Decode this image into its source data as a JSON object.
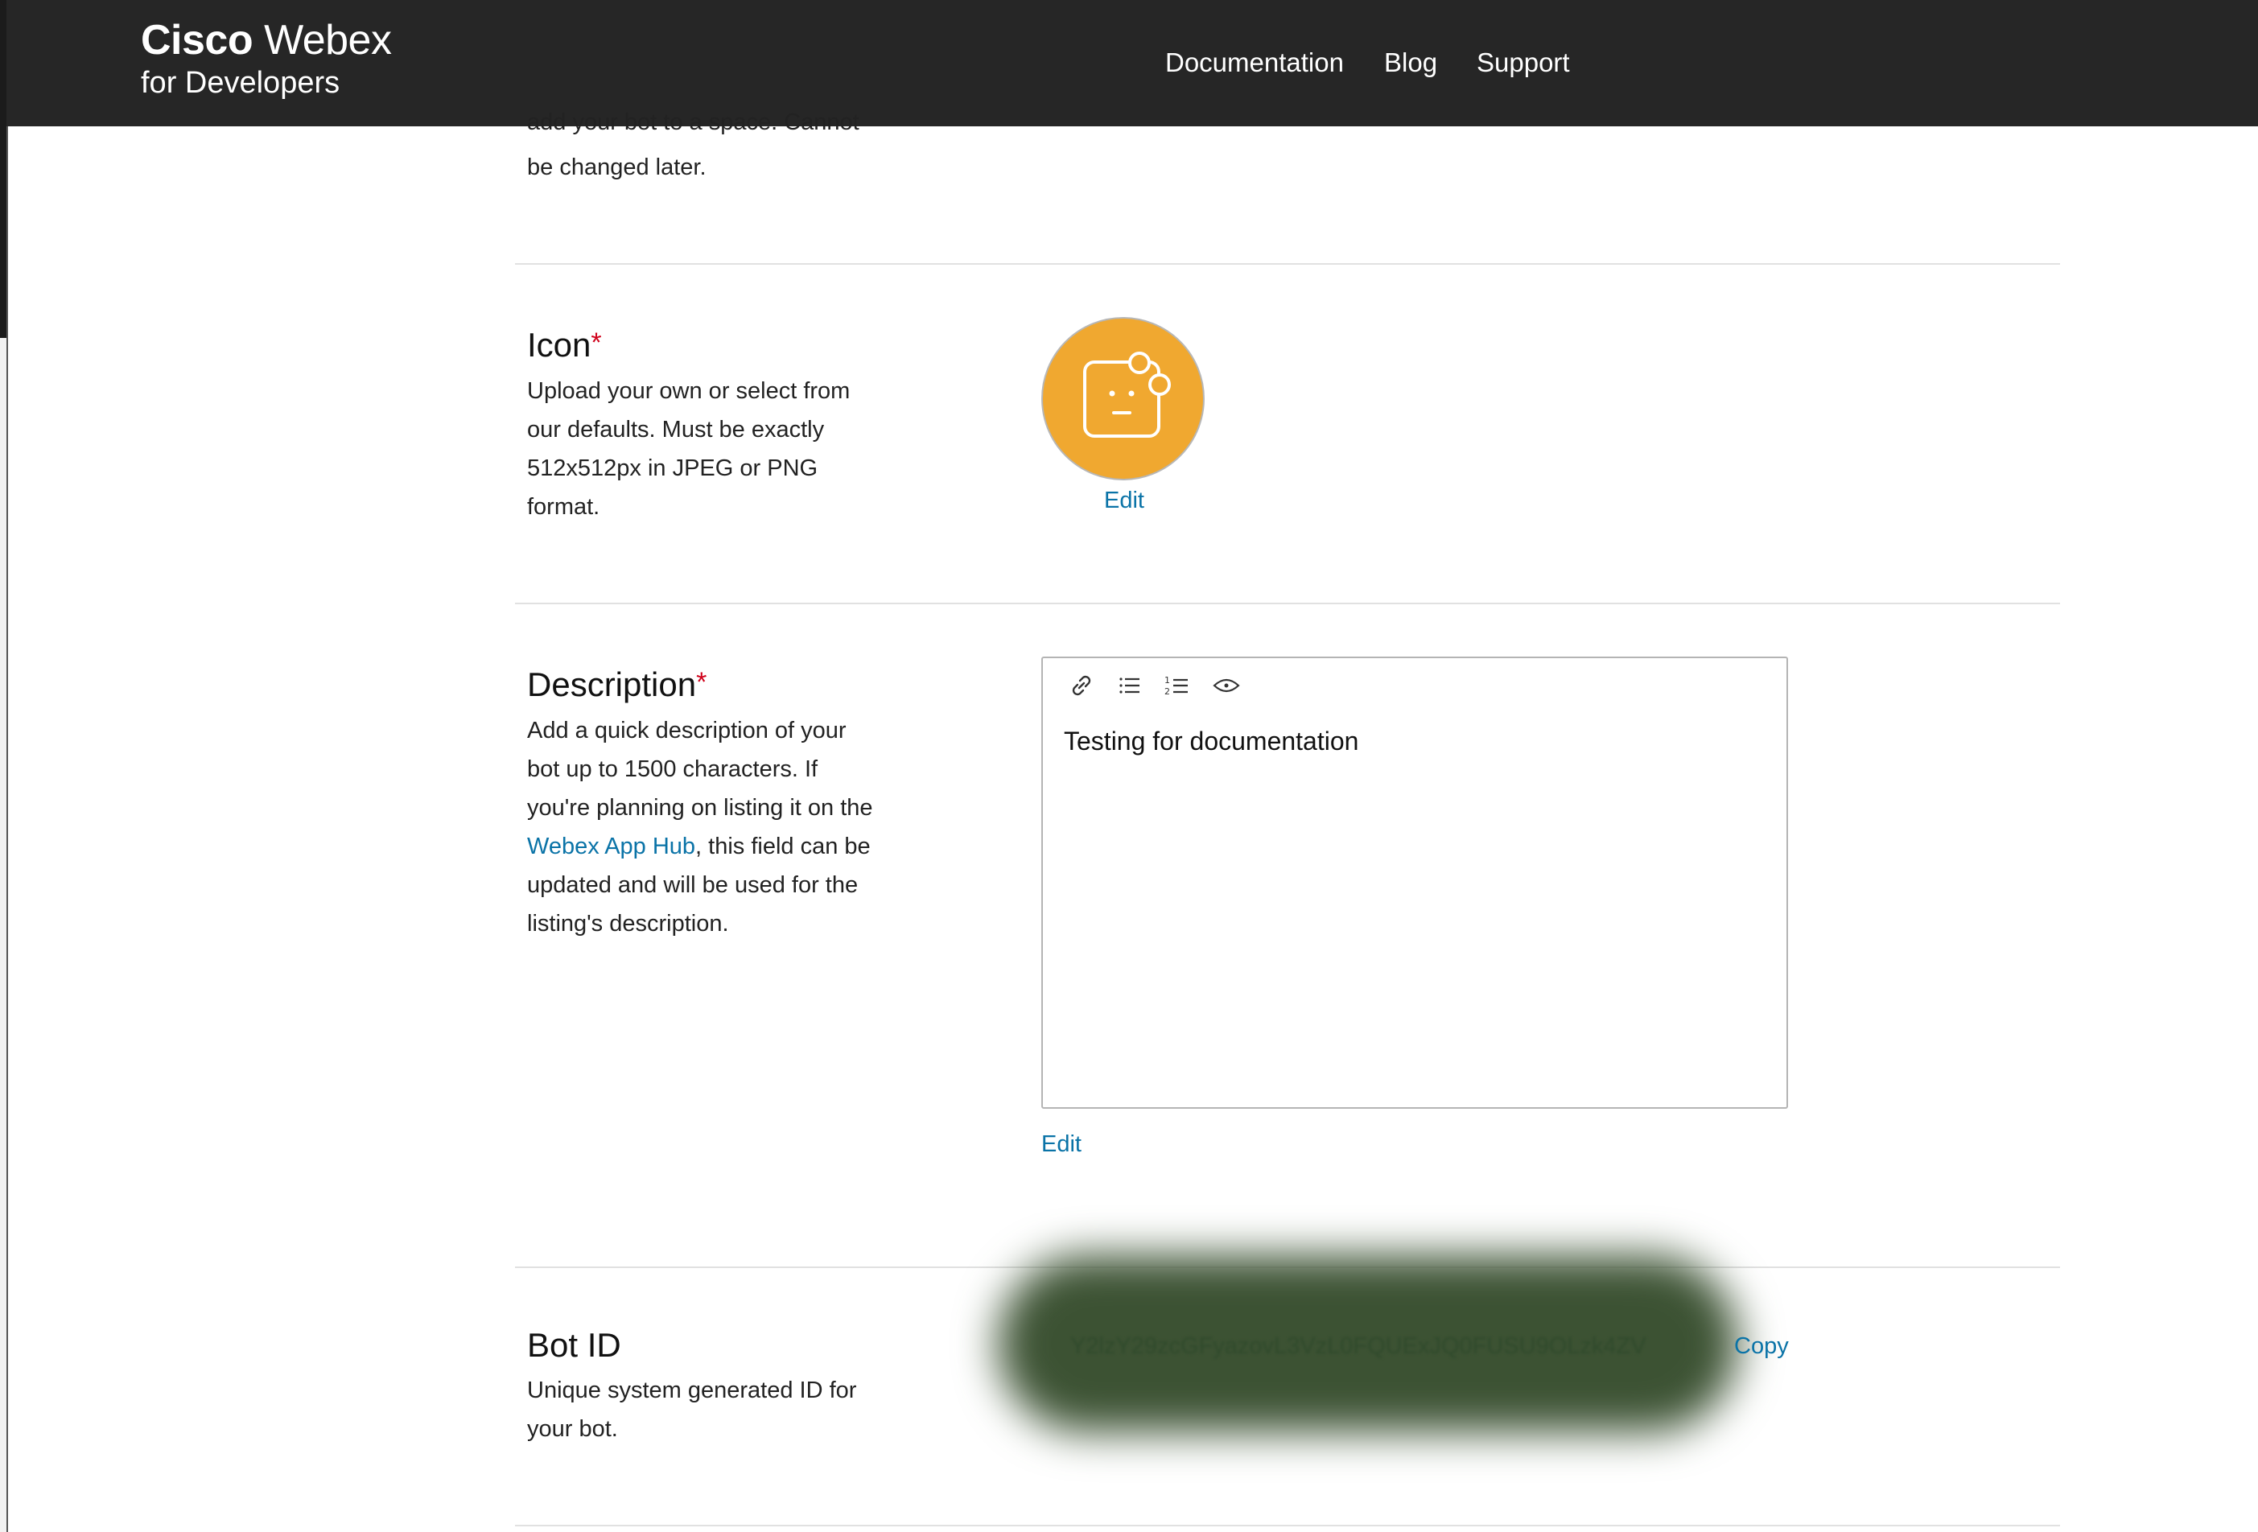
{
  "header": {
    "brand_bold": "Cisco",
    "brand_light": "Webex",
    "brand_sub": "for Developers",
    "nav": [
      "Documentation",
      "Blog",
      "Support"
    ]
  },
  "username_section": {
    "desc_partial_line1": "add your bot to a space. Cannot",
    "desc_partial_line2": "be changed later."
  },
  "icon_section": {
    "title": "Icon",
    "required": "*",
    "desc": [
      "Upload your own or select from",
      "our defaults. Must be exactly",
      "512x512px in JPEG or PNG",
      "format."
    ],
    "edit_label": "Edit",
    "avatar_color": "#f0a830",
    "avatar_icon": "bot-face-icon"
  },
  "description_section": {
    "title": "Description",
    "required": "*",
    "desc_line1": "Add a quick description of your",
    "desc_line2": "bot up to 1500 characters. If",
    "desc_line3": "you're planning on listing it on the",
    "desc_link": "Webex App Hub",
    "desc_line4_rest": ", this field can be",
    "desc_line5": "updated and will be used for the",
    "desc_line6": "listing's description.",
    "toolbar_icons": [
      "link-icon",
      "bulleted-list-icon",
      "numbered-list-icon",
      "preview-eye-icon"
    ],
    "editor_text": "Testing for documentation",
    "edit_label": "Edit"
  },
  "botid_section": {
    "title": "Bot ID",
    "desc": [
      "Unique system generated ID for",
      "your bot."
    ],
    "value": "Y2lzY29zcGFyazovL3VzL0FQUExJQ0FUSU9OLzk4ZV",
    "copy_label": "Copy"
  },
  "colors": {
    "header_bg": "#262626",
    "link": "#0a73a7",
    "required": "#d0021b"
  }
}
